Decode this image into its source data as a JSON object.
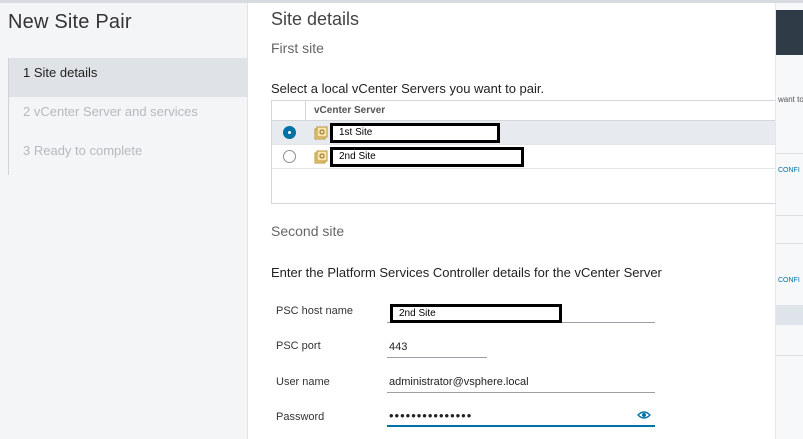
{
  "wizard": {
    "title": "New Site Pair",
    "steps": [
      {
        "label": "1 Site details",
        "active": true
      },
      {
        "label": "2 vCenter Server and services",
        "active": false
      },
      {
        "label": "3 Ready to complete",
        "active": false
      }
    ]
  },
  "main": {
    "title": "Site details",
    "first_site": {
      "heading": "First site",
      "instruction": "Select a local vCenter Servers you want to pair.",
      "column_header": "vCenter Server",
      "rows": [
        {
          "name": "1st Site",
          "selected": true
        },
        {
          "name": "2nd Site",
          "selected": false
        }
      ]
    },
    "second_site": {
      "heading": "Second site",
      "instruction": "Enter the Platform Services Controller details for the vCenter Server",
      "psc_host": {
        "label": "PSC host name",
        "value": "2nd Site"
      },
      "psc_port": {
        "label": "PSC port",
        "value": "443"
      },
      "user_name": {
        "label": "User name",
        "value": "administrator@vsphere.local"
      },
      "password": {
        "label": "Password",
        "value": "•••••••••••••••"
      }
    }
  },
  "background": {
    "text_fragment": "want to",
    "link_1": "CONFI",
    "link_2": "CONFI"
  },
  "colors": {
    "accent": "#0072a3",
    "active_step_bg": "#dfe2e6"
  },
  "icons": [
    "vcenter-icon",
    "eye-icon"
  ]
}
